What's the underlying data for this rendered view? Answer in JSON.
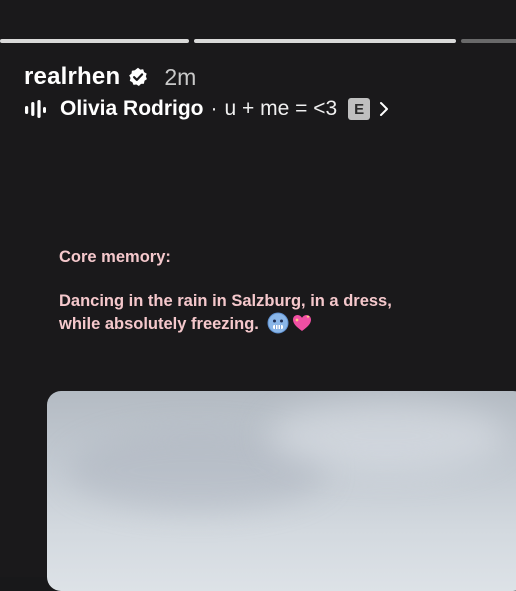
{
  "story": {
    "progress_segments": [
      {
        "state": "done",
        "fill": 1.0
      },
      {
        "state": "active",
        "fill": 1.0
      },
      {
        "state": "upcoming",
        "fill": 0.0
      }
    ]
  },
  "header": {
    "username": "realrhen",
    "verified_icon": "verified-badge-icon",
    "timestamp": "2m"
  },
  "music": {
    "icon": "audio-bars-icon",
    "artist": "Olivia Rodrigo",
    "separator": "·",
    "song": "u + me = <3",
    "explicit_label": "E",
    "chevron_icon": "chevron-right-icon"
  },
  "caption": {
    "line1": "Core memory:",
    "line2": "Dancing in the rain in Salzburg, in a dress,",
    "line3": "while absolutely freezing.",
    "emojis": [
      "cold-face-emoji",
      "sparkling-heart-emoji"
    ],
    "color": "#f5c8cc"
  },
  "photo": {
    "description_icon": "photo-thumbnail"
  },
  "colors": {
    "background": "#1a191b",
    "caption_pink": "#f5c8cc",
    "explicit_badge": "#bfbfbf"
  }
}
